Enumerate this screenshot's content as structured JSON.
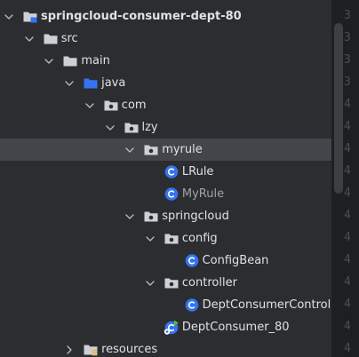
{
  "tree": {
    "items": [
      {
        "label": "springcloud-consumer-dept-80",
        "icon": "module-folder-icon",
        "expanded": true,
        "bold": true,
        "dim": false,
        "selected": false,
        "depth": 0
      },
      {
        "label": "src",
        "icon": "folder-icon",
        "expanded": true,
        "bold": false,
        "dim": false,
        "selected": false,
        "depth": 1
      },
      {
        "label": "main",
        "icon": "folder-icon",
        "expanded": true,
        "bold": false,
        "dim": false,
        "selected": false,
        "depth": 2
      },
      {
        "label": "java",
        "icon": "source-root-folder-icon",
        "expanded": true,
        "bold": false,
        "dim": false,
        "selected": false,
        "depth": 3
      },
      {
        "label": "com",
        "icon": "package-icon",
        "expanded": true,
        "bold": false,
        "dim": false,
        "selected": false,
        "depth": 4
      },
      {
        "label": "lzy",
        "icon": "package-icon",
        "expanded": true,
        "bold": false,
        "dim": false,
        "selected": false,
        "depth": 5
      },
      {
        "label": "myrule",
        "icon": "package-icon",
        "expanded": true,
        "bold": false,
        "dim": false,
        "selected": true,
        "depth": 6
      },
      {
        "label": "LRule",
        "icon": "class-icon",
        "expanded": null,
        "bold": false,
        "dim": false,
        "selected": false,
        "depth": 7
      },
      {
        "label": "MyRule",
        "icon": "class-icon",
        "expanded": null,
        "bold": false,
        "dim": true,
        "selected": false,
        "depth": 7
      },
      {
        "label": "springcloud",
        "icon": "package-icon",
        "expanded": true,
        "bold": false,
        "dim": false,
        "selected": false,
        "depth": 6
      },
      {
        "label": "config",
        "icon": "package-icon",
        "expanded": true,
        "bold": false,
        "dim": false,
        "selected": false,
        "depth": 7
      },
      {
        "label": "ConfigBean",
        "icon": "class-icon",
        "expanded": null,
        "bold": false,
        "dim": false,
        "selected": false,
        "depth": 8
      },
      {
        "label": "controller",
        "icon": "package-icon",
        "expanded": true,
        "bold": false,
        "dim": false,
        "selected": false,
        "depth": 7
      },
      {
        "label": "DeptConsumerControlle",
        "icon": "class-icon",
        "expanded": null,
        "bold": false,
        "dim": false,
        "selected": false,
        "depth": 8
      },
      {
        "label": "DeptConsumer_80",
        "icon": "spring-boot-main-class-icon",
        "expanded": null,
        "bold": false,
        "dim": false,
        "selected": false,
        "depth": 7
      },
      {
        "label": "resources",
        "icon": "resources-folder-icon",
        "expanded": false,
        "bold": false,
        "dim": false,
        "selected": false,
        "depth": 3
      }
    ]
  },
  "gutter": {
    "digits": [
      "3",
      "3",
      "3",
      "3",
      "4",
      "4",
      "4",
      "4",
      "4",
      "4",
      "4",
      "4",
      "4",
      "4",
      "4",
      "4"
    ]
  },
  "colors": {
    "background": "#2b2d30",
    "selection": "#43454a",
    "text": "#dfe1e5",
    "text_dim": "#9fa2a8",
    "folder": "#ced0d6",
    "source_root": "#3574f0",
    "class_icon": "#3574f0",
    "spring_green": "#5fb832",
    "resources_stripes": "#e5b83a",
    "gutter_bg": "#1e1f22",
    "gutter_text": "#4b4e52"
  }
}
